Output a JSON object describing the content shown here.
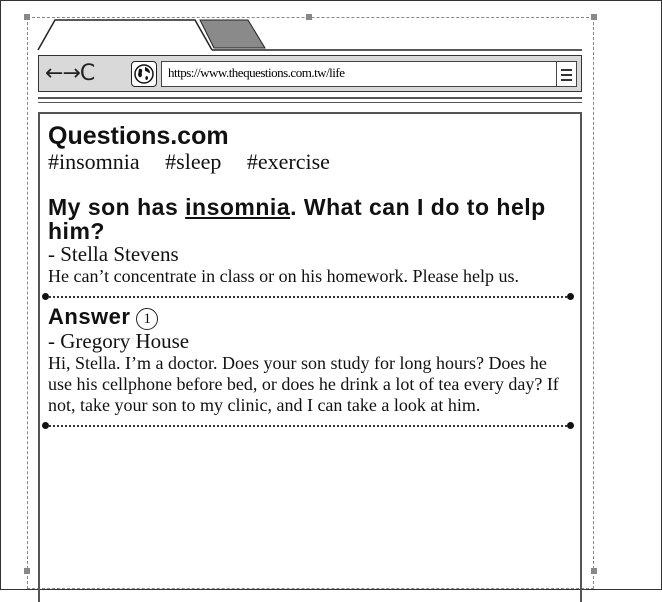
{
  "browser": {
    "nav_glyphs": "←→C",
    "url": "https://www.thequestions.com.tw/life",
    "menu_icon": "hamburger-icon",
    "globe_icon": "globe-icon"
  },
  "page": {
    "site_title": "Questions.com",
    "tags": [
      "#insomnia",
      "#sleep",
      "#exercise"
    ],
    "question": {
      "title_before": "My son has ",
      "title_keyword": "insomnia",
      "title_after": ".   What can I do to help him?",
      "author": "- Stella Stevens",
      "body": "He can’t concentrate in class or on his homework.   Please help us."
    },
    "answer": {
      "heading": "Answer",
      "number": "1",
      "author": "- Gregory House",
      "body": "Hi, Stella.   I’m a doctor.   Does your son study for long hours?   Does he use his cellphone before bed, or does he drink a lot of tea every day?   If not, take your son to my clinic, and I can take a look at him."
    }
  }
}
